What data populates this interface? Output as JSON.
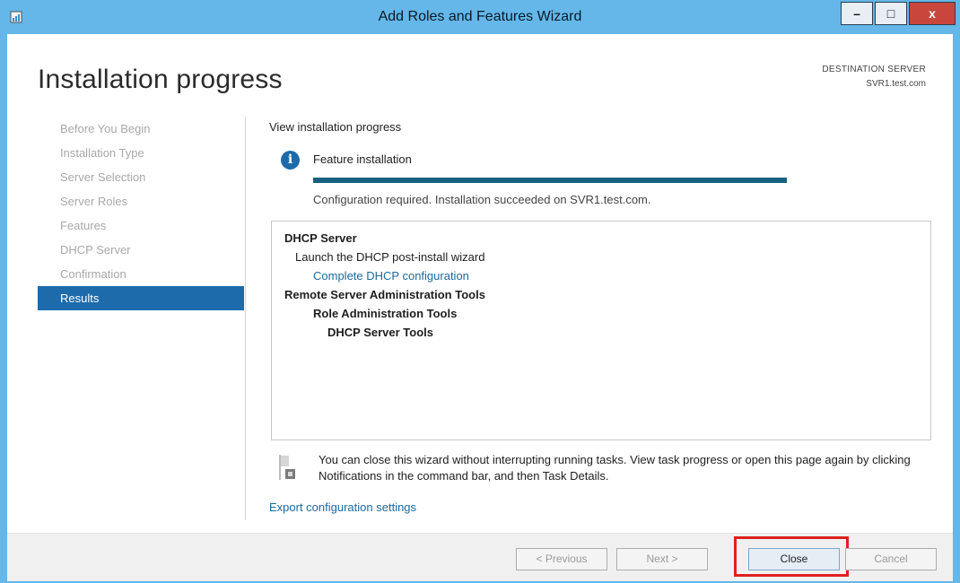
{
  "window": {
    "title": "Add Roles and Features Wizard",
    "app_icon": "server-manager-icon",
    "controls": {
      "minimize": "–",
      "maximize": "□",
      "close": "x"
    }
  },
  "page": {
    "title": "Installation progress",
    "destination_label": "DESTINATION SERVER",
    "destination_server": "SVR1.test.com"
  },
  "nav": {
    "items": [
      {
        "label": "Before You Begin",
        "active": false
      },
      {
        "label": "Installation Type",
        "active": false
      },
      {
        "label": "Server Selection",
        "active": false
      },
      {
        "label": "Server Roles",
        "active": false
      },
      {
        "label": "Features",
        "active": false
      },
      {
        "label": "DHCP Server",
        "active": false
      },
      {
        "label": "Confirmation",
        "active": false
      },
      {
        "label": "Results",
        "active": true
      }
    ]
  },
  "content": {
    "heading": "View installation progress",
    "info_icon": "info-icon",
    "feature_label": "Feature installation",
    "progress_fraction": 1.0,
    "status_text": "Configuration required. Installation succeeded on SVR1.test.com.",
    "results": [
      {
        "text": "DHCP Server",
        "style": "bold",
        "level": 0
      },
      {
        "text": "Launch the DHCP post-install wizard",
        "style": "normal",
        "level": 1
      },
      {
        "text": "Complete DHCP configuration",
        "style": "link",
        "level": "1b"
      },
      {
        "text": "Remote Server Administration Tools",
        "style": "bold",
        "level": 0
      },
      {
        "text": "Role Administration Tools",
        "style": "bold",
        "level": "1b"
      },
      {
        "text": "DHCP Server Tools",
        "style": "bold",
        "level": 2
      }
    ],
    "note_icon": "flag-icon",
    "note_text": "You can close this wizard without interrupting running tasks. View task progress or open this page again by clicking Notifications in the command bar, and then Task Details.",
    "export_link": "Export configuration settings"
  },
  "footer": {
    "previous": "< Previous",
    "next": "Next >",
    "close": "Close",
    "cancel": "Cancel"
  },
  "colors": {
    "titlebar": "#64b7e8",
    "nav_active": "#1d6bab",
    "progress": "#15617f",
    "link": "#1b6a9e",
    "highlight": "#e02020"
  }
}
